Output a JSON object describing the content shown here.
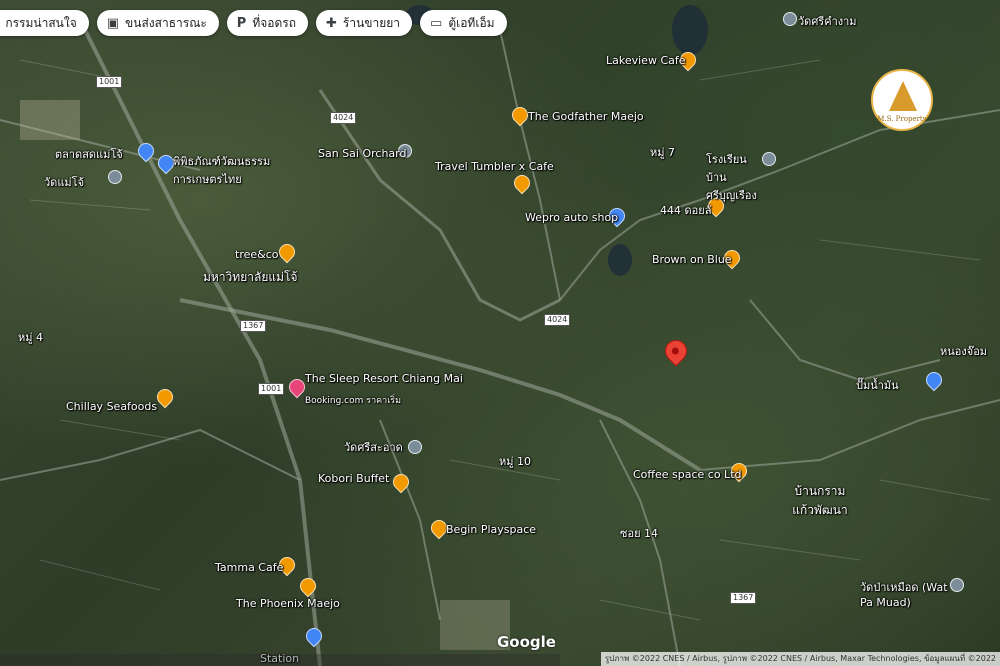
{
  "chips": [
    {
      "icon": "landmark-icon",
      "label": "กรรมน่าสนใจ"
    },
    {
      "icon": "bus-icon",
      "label": "ขนส่งสาธารณะ"
    },
    {
      "icon": "parking-icon",
      "label": "ที่จอดรถ"
    },
    {
      "icon": "pharmacy-icon",
      "label": "ร้านขายยา"
    },
    {
      "icon": "atm-icon",
      "label": "ตู้เอทีเอ็ม"
    }
  ],
  "places": [
    {
      "name": "Lakeview Cafe",
      "pin": "orange"
    },
    {
      "name": "The Godfather Maejo",
      "pin": "orange"
    },
    {
      "name": "Travel Tumbler x Cafe",
      "pin": "orange"
    },
    {
      "name": "San Sai Orchard",
      "pin": "grey"
    },
    {
      "name": "Wepro auto shop",
      "pin": "blue"
    },
    {
      "name": "444 ดอยลั",
      "pin": "orange"
    },
    {
      "name": "Brown on Blue",
      "pin": "orange"
    },
    {
      "name": "The Sleep Resort Chiang Mai",
      "pin": "pink"
    },
    {
      "name": "Booking.com ราคาเริ่ม",
      "pin": ""
    },
    {
      "name": "Chillay Seafoods",
      "pin": "orange"
    },
    {
      "name": "Coffee space co Ltd",
      "pin": "orange"
    },
    {
      "name": "Begin Playspace",
      "pin": "orange"
    },
    {
      "name": "Tamma Cafe",
      "pin": "orange"
    },
    {
      "name": "The Phoenix Maejo",
      "pin": "orange"
    },
    {
      "name": "tree&co",
      "pin": "orange"
    },
    {
      "name": "มหาวิทยาลัยแม่โจ้",
      "pin": ""
    },
    {
      "name": "วัดศรีคำงาม",
      "pin": "grey"
    },
    {
      "name": "ตลาดสดแม่โจ้",
      "pin": "blue"
    },
    {
      "name": "พิพิธภัณฑ์วัฒนธรรมการเกษตรไทย",
      "pin": "blue"
    },
    {
      "name": "วัดแม่โจ้",
      "pin": "grey"
    },
    {
      "name": "Kobori Buffet",
      "pin": "orange"
    },
    {
      "name": "วัดศรีสะอาด",
      "pin": "grey"
    },
    {
      "name": "โรงเรียนบ้านศรีบุญเรือง",
      "pin": "grey"
    },
    {
      "name": "วัดป่าเหมือด (Wat Pa Muad)",
      "pin": "grey"
    },
    {
      "name": "บ้านกรามแก้วพัฒนา",
      "pin": ""
    },
    {
      "name": "หนองจ๊อม",
      "pin": ""
    },
    {
      "name": "ปั๊มน้ำมัน",
      "pin": "blue"
    },
    {
      "name": "หมู่ 7",
      "pin": ""
    },
    {
      "name": "หมู่ 4",
      "pin": ""
    },
    {
      "name": "หมู่ 10",
      "pin": ""
    },
    {
      "name": "ซอย 14",
      "pin": ""
    },
    {
      "name": "Station",
      "pin": "blue"
    }
  ],
  "road_shields": [
    "1001",
    "1367",
    "1001",
    "4024",
    "4024",
    "1367"
  ],
  "logo": {
    "text": "M.S. Property"
  },
  "google_label": "Google",
  "attribution": "รูปภาพ ©2022 CNES / Airbus, รูปภาพ ©2022 CNES / Airbus, Maxar Technologies, ข้อมูลแผนที่ ©2022"
}
